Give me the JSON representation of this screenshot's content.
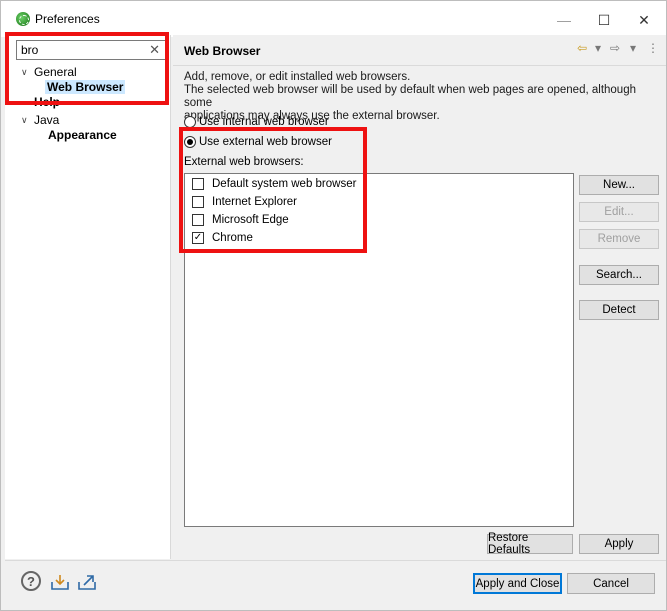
{
  "window": {
    "title": "Preferences",
    "minimize": "—",
    "maximize": "☐",
    "close": "✕"
  },
  "sidebar": {
    "filter": {
      "value": "bro",
      "clear": "✕"
    },
    "tree": [
      {
        "label": "General",
        "expanded": true
      },
      {
        "label": "Web Browser",
        "selected": true
      },
      {
        "label": "Help"
      },
      {
        "label": "Java",
        "expanded": true
      },
      {
        "label": "Appearance"
      }
    ]
  },
  "page": {
    "title": "Web Browser",
    "nav": {
      "back": "⇦",
      "back_menu": "▾",
      "forward": "⇨",
      "forward_menu": "▾",
      "more": "⋮"
    },
    "description": [
      "Add, remove, or edit installed web browsers.",
      "The selected web browser will be used by default when web pages are opened, although some",
      "applications may always use the external browser."
    ],
    "radio_internal": "Use internal web browser",
    "radio_external": "Use external web browser",
    "external_label": "External web browsers:",
    "browsers": [
      {
        "label": "Default system web browser",
        "checked": false
      },
      {
        "label": "Internet Explorer",
        "checked": false
      },
      {
        "label": "Microsoft Edge",
        "checked": false
      },
      {
        "label": "Chrome",
        "checked": true
      }
    ],
    "buttons": {
      "new": "New...",
      "edit": "Edit...",
      "remove": "Remove",
      "search": "Search...",
      "detect": "Detect"
    },
    "restore_defaults": "Restore Defaults",
    "apply": "Apply"
  },
  "footer": {
    "apply_close": "Apply and Close",
    "cancel": "Cancel"
  },
  "colors": {
    "highlight": "#ee1111",
    "selection": "#cce8ff"
  }
}
